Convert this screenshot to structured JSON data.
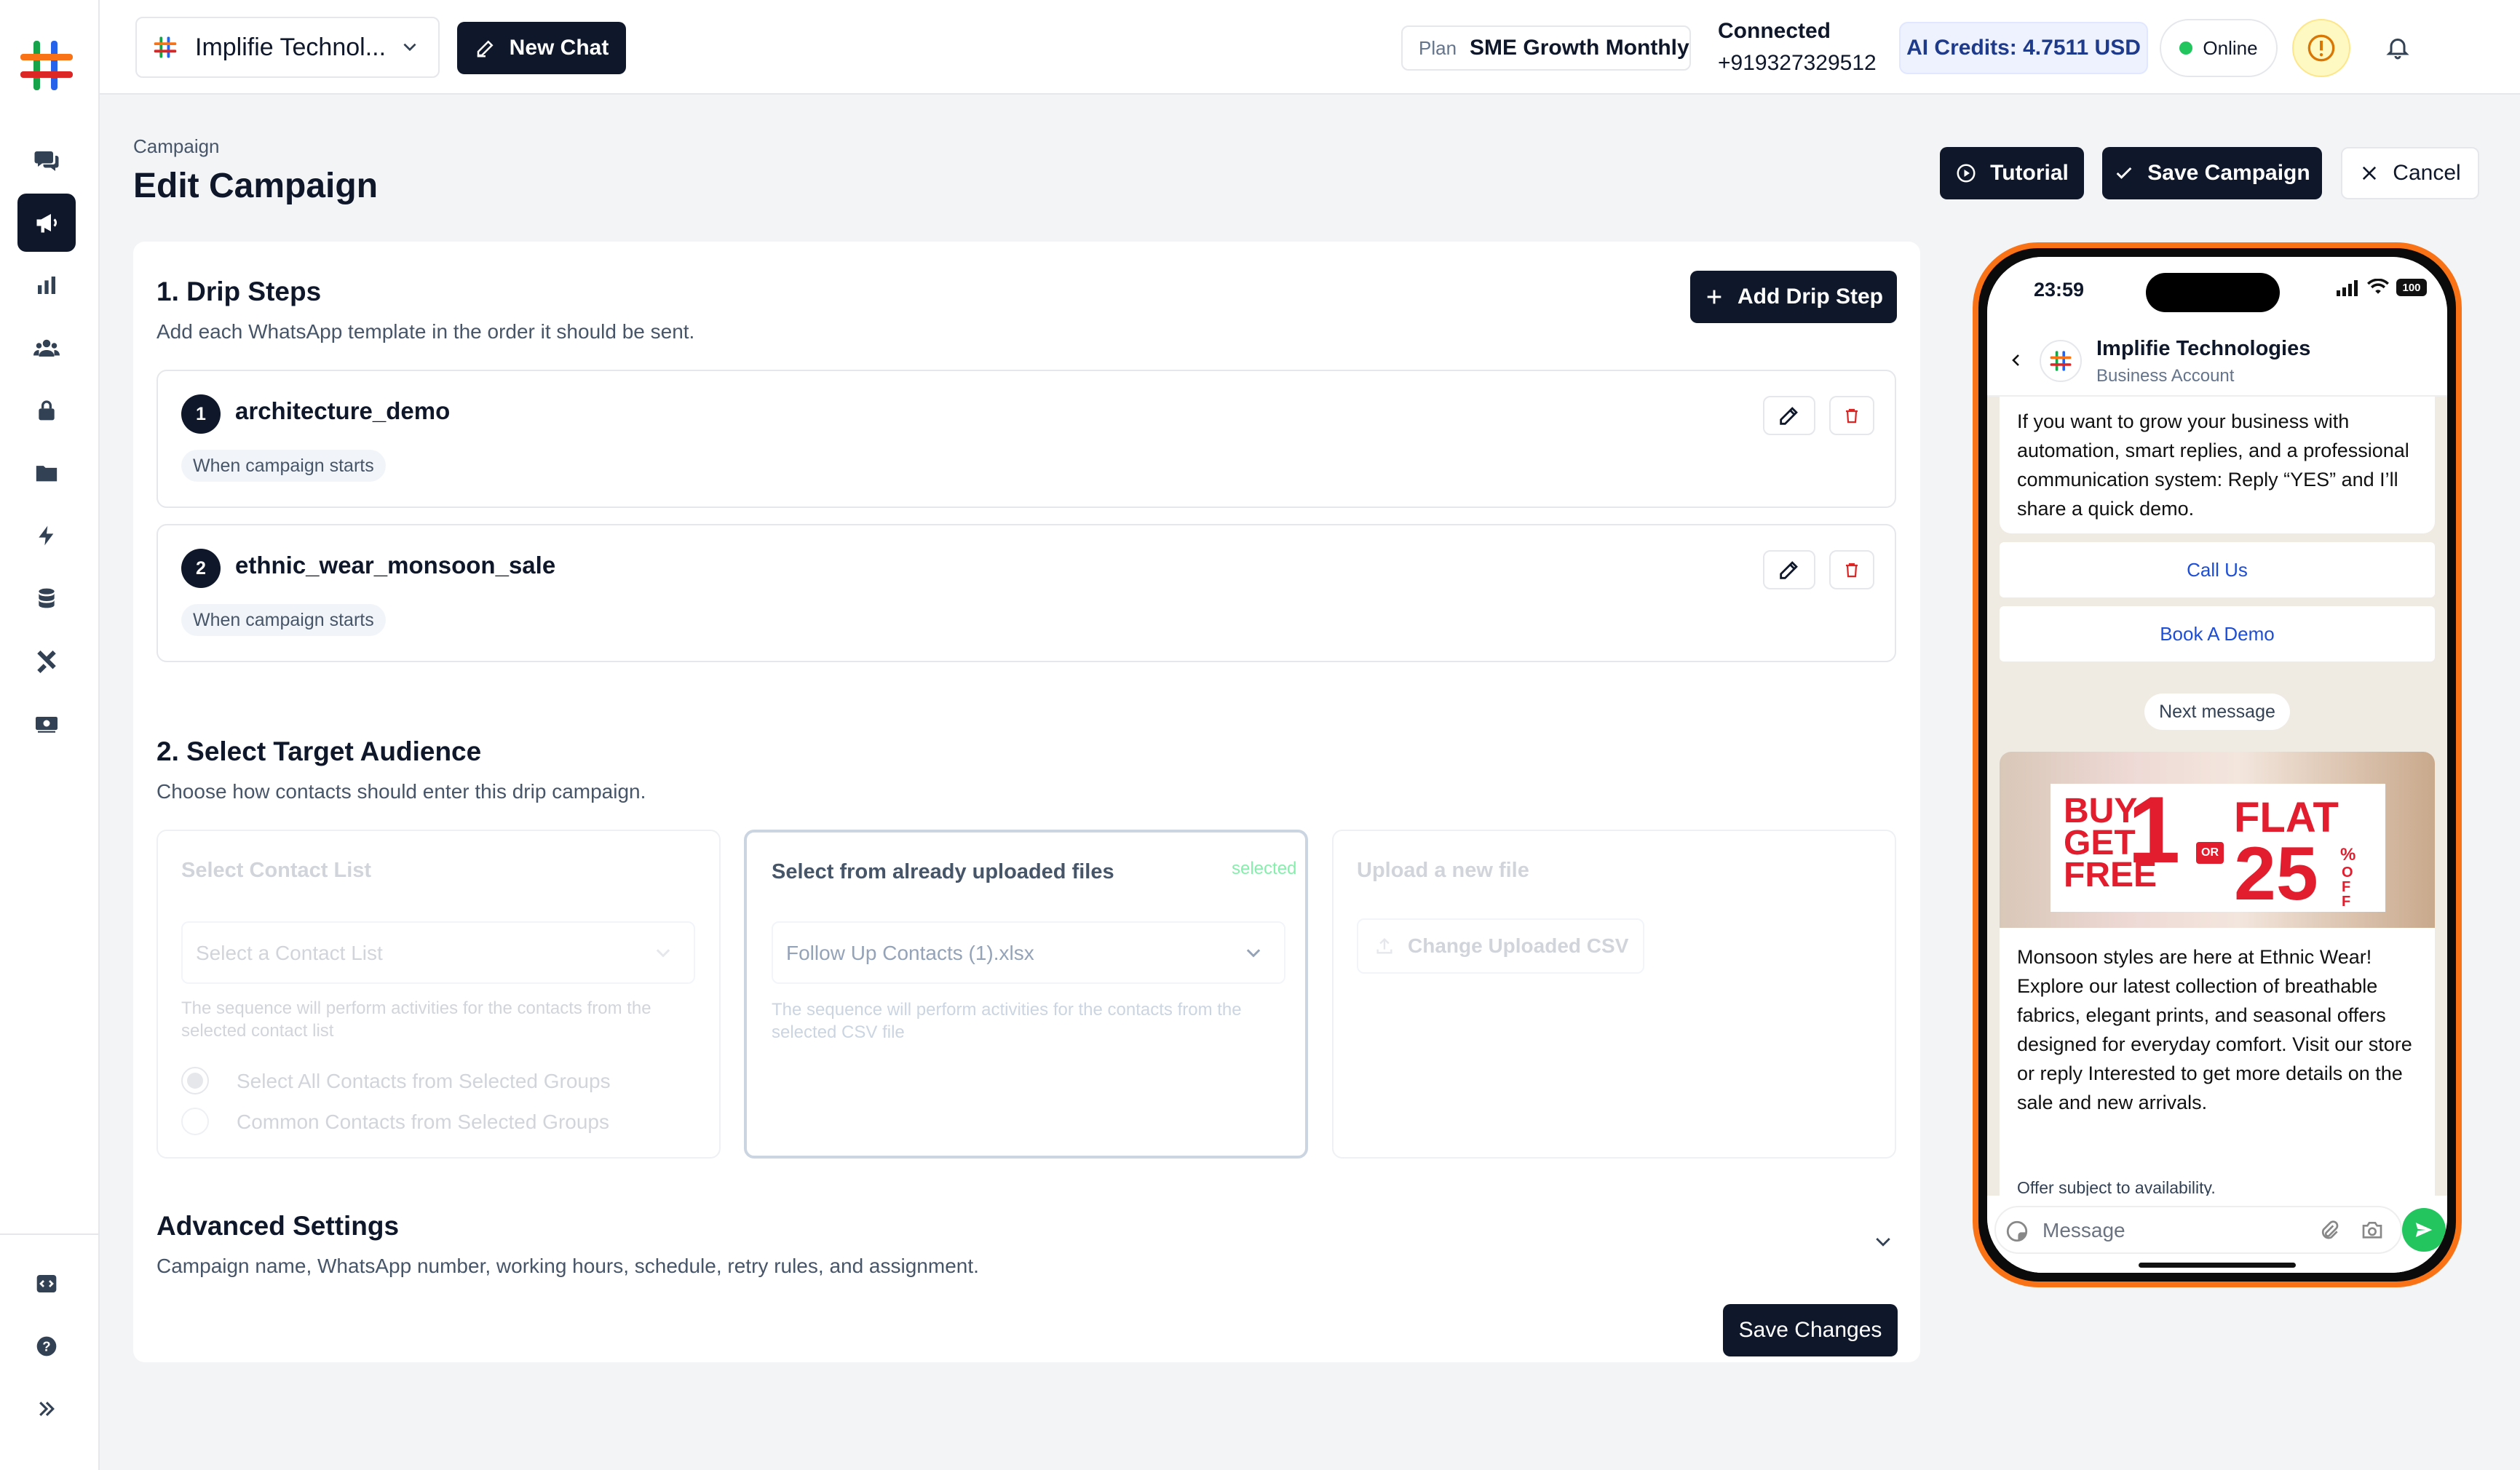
{
  "sidebar": {
    "logo": "brand-logo",
    "items": [
      "chat-icon",
      "campaign-icon",
      "analytics-icon",
      "contacts-icon",
      "lock-icon",
      "folder-icon",
      "flash-icon",
      "database-icon",
      "tools-icon",
      "billing-icon"
    ],
    "bottom_items": [
      "code-icon",
      "help-icon",
      "expand-icon"
    ]
  },
  "topbar": {
    "workspace_name": "Implifie Technol...",
    "new_chat_label": "New Chat",
    "plan_label": "Plan",
    "plan_name": "SME Growth Monthly",
    "connected_label": "Connected",
    "connected_number": "+919327329512",
    "ai_credits": "AI Credits: 4.7511 USD",
    "status": "Online"
  },
  "page": {
    "breadcrumb": "Campaign",
    "title": "Edit Campaign",
    "tutorial_label": "Tutorial",
    "save_campaign_label": "Save Campaign",
    "cancel_label": "Cancel"
  },
  "drip": {
    "title": "1. Drip Steps",
    "subtitle": "Add each WhatsApp template in the order it should be sent.",
    "add_label": "Add Drip Step",
    "steps": [
      {
        "num": "1",
        "name": "architecture_demo",
        "trigger": "When campaign starts"
      },
      {
        "num": "2",
        "name": "ethnic_wear_monsoon_sale",
        "trigger": "When campaign starts"
      }
    ]
  },
  "audience": {
    "title": "2. Select Target Audience",
    "subtitle": "Choose how contacts should enter this drip campaign.",
    "contact_list": {
      "title": "Select Contact List",
      "placeholder": "Select a Contact List",
      "help": "The sequence will perform activities for the contacts from the selected contact list",
      "option_all": "Select All Contacts from Selected Groups",
      "option_common": "Common Contacts from Selected Groups"
    },
    "uploaded": {
      "title": "Select from already uploaded files",
      "badge": "selected",
      "value": "Follow Up Contacts (1).xlsx",
      "help": "The sequence will perform activities for the contacts from the selected CSV file"
    },
    "upload_new": {
      "title": "Upload a new file",
      "button": "Change Uploaded CSV"
    }
  },
  "advanced": {
    "title": "Advanced Settings",
    "subtitle": "Campaign name, WhatsApp number, working hours, schedule, retry rules, and assignment.",
    "save_label": "Save Changes"
  },
  "phone": {
    "time": "23:59",
    "battery": "100",
    "business_name": "Implifie Technologies",
    "account_type": "Business Account",
    "message1": "If you want to grow your business with automation, smart replies, and a professional communication system: Reply “YES” and I’ll share a quick demo.",
    "button1": "Call Us",
    "button2": "Book A Demo",
    "divider": "Next message",
    "banner": {
      "left_top": "BUY",
      "left_num": "1",
      "left_mid": "GET",
      "left_bottom": "FREE",
      "or": "OR",
      "flat": "FLAT",
      "right_num": "25",
      "pct": "%",
      "off": "OFF"
    },
    "message2": "Monsoon styles are here at Ethnic Wear! Explore our latest collection of breathable fabrics, elegant prints, and seasonal offers designed for everyday comfort. Visit our store or reply Interested to get more details on the sale and new arrivals.",
    "footer": "Offer subject to availability.",
    "input_placeholder": "Message"
  },
  "colors": {
    "primary": "#0f172a",
    "accent_orange": "#f97316",
    "online_green": "#22c55e",
    "whatsapp_green": "#22c55e",
    "delete_red": "#dc2626",
    "credits_bg": "#eef2ff"
  }
}
